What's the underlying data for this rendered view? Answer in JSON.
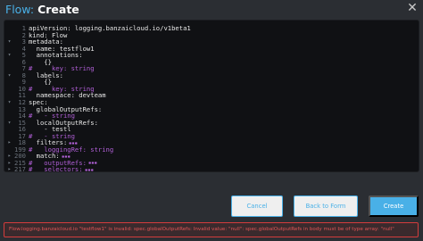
{
  "header": {
    "kind": "Flow",
    "separator": ":",
    "action": "Create",
    "close_icon": "close-icon"
  },
  "editor": {
    "lines": [
      {
        "fold": "",
        "num": "1",
        "text": "apiVersion: logging.banzaicloud.io/v1beta1",
        "style": "key"
      },
      {
        "fold": "",
        "num": "2",
        "text": "kind: Flow",
        "style": "key"
      },
      {
        "fold": "▾",
        "num": "3",
        "text": "metadata:",
        "style": "key"
      },
      {
        "fold": "",
        "num": "4",
        "text": "  name: testflow1",
        "style": "key"
      },
      {
        "fold": "▾",
        "num": "5",
        "text": "  annotations:",
        "style": "key"
      },
      {
        "fold": "",
        "num": "6",
        "text": "    {}",
        "style": "key"
      },
      {
        "fold": "",
        "num": "7",
        "text": "#     key: string",
        "style": "com"
      },
      {
        "fold": "▾",
        "num": "8",
        "text": "  labels:",
        "style": "key"
      },
      {
        "fold": "",
        "num": "9",
        "text": "    {}",
        "style": "key"
      },
      {
        "fold": "",
        "num": "10",
        "text": "#     key: string",
        "style": "com"
      },
      {
        "fold": "",
        "num": "11",
        "text": "  namespace: devteam",
        "style": "key"
      },
      {
        "fold": "▾",
        "num": "12",
        "text": "spec:",
        "style": "key"
      },
      {
        "fold": "",
        "num": "13",
        "text": "  globalOutputRefs:",
        "style": "key"
      },
      {
        "fold": "",
        "num": "14",
        "text": "#   - string",
        "style": "com"
      },
      {
        "fold": "▾",
        "num": "15",
        "text": "  localOutputRefs:",
        "style": "key"
      },
      {
        "fold": "",
        "num": "16",
        "text": "    - testl",
        "style": "key"
      },
      {
        "fold": "",
        "num": "17",
        "text": "#   - string",
        "style": "com"
      },
      {
        "fold": "▸",
        "num": "18",
        "text": "  filters:",
        "style": "key",
        "collapsed": true
      },
      {
        "fold": "",
        "num": "199",
        "text": "#   loggingRef: string",
        "style": "com"
      },
      {
        "fold": "▸",
        "num": "200",
        "text": "  match:",
        "style": "key",
        "collapsed": true
      },
      {
        "fold": "▸",
        "num": "215",
        "text": "#   outputRefs:",
        "style": "com",
        "collapsed": true
      },
      {
        "fold": "▸",
        "num": "217",
        "text": "#   selectors:",
        "style": "com",
        "collapsed": true
      }
    ]
  },
  "buttons": {
    "cancel": "Cancel",
    "back": "Back to Form",
    "create": "Create"
  },
  "error": {
    "message": "Flow.logging.banzaicloud.io \"testflow1\" is invalid: spec.globalOutputRefs: Invalid value: \"null\": spec.globalOutputRefs in body must be of type array: \"null\""
  },
  "colors": {
    "accent": "#49b0e7",
    "error": "#e05555",
    "comment": "#b05fd6",
    "editor_bg": "#101114",
    "page_bg": "#2b2e33"
  }
}
